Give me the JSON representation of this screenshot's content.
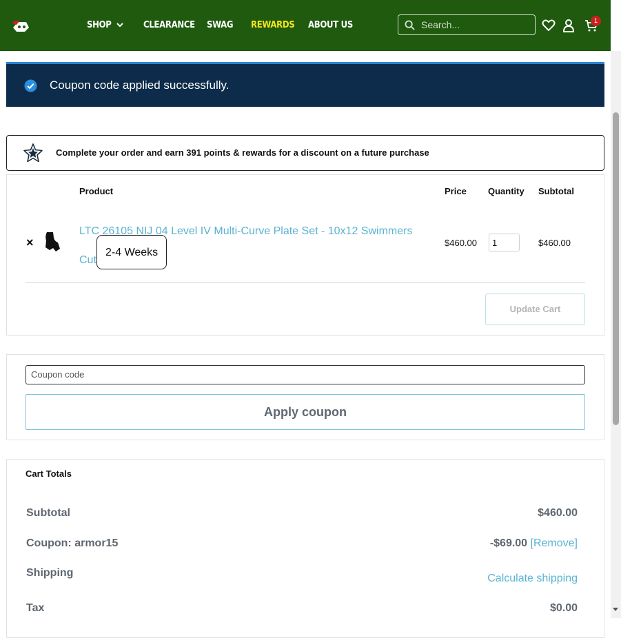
{
  "header": {
    "nav": [
      "SHOP",
      "CLEARANCE",
      "SWAG",
      "REWARDS",
      "ABOUT US"
    ],
    "search_placeholder": "Search...",
    "cart_count": "1",
    "colors": {
      "bg": "#1f5a0f",
      "rewards": "#f4e41d",
      "badge": "#c92020"
    }
  },
  "notice": {
    "message": "Coupon code applied successfully."
  },
  "rewards_banner": {
    "text": "Complete your order and earn 391 points & rewards for a discount on a future purchase"
  },
  "cart": {
    "columns": {
      "product": "Product",
      "price": "Price",
      "quantity": "Quantity",
      "subtotal": "Subtotal"
    },
    "items": [
      {
        "name": "LTC 26105 NIJ 04 Level IV Multi-Curve Plate Set - 10x12 Swimmers Cut",
        "tooltip": "2-4 Weeks",
        "price": "$460.00",
        "quantity": "1",
        "subtotal": "$460.00",
        "remove_symbol": "×"
      }
    ],
    "update_label": "Update Cart"
  },
  "coupon": {
    "placeholder": "Coupon code",
    "apply_label": "Apply coupon"
  },
  "totals": {
    "title": "Cart Totals",
    "subtotal_label": "Subtotal",
    "subtotal_value": "$460.00",
    "coupon_label": "Coupon: armor15",
    "coupon_value": "-$69.00",
    "coupon_remove": "[Remove]",
    "shipping_label": "Shipping",
    "shipping_link": "Calculate shipping",
    "tax_label": "Tax",
    "tax_value": "$0.00"
  }
}
